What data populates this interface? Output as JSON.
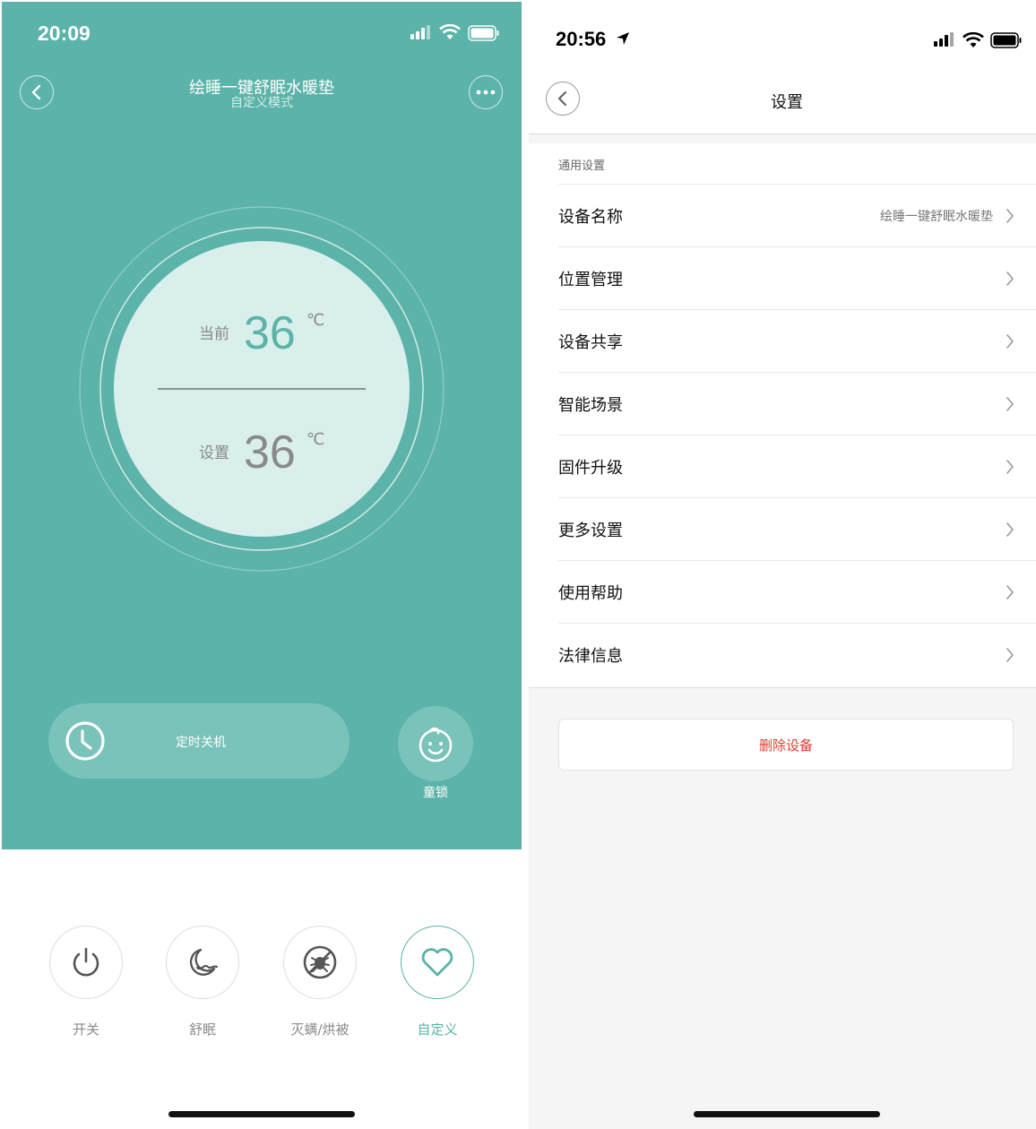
{
  "left": {
    "status_time": "20:09",
    "title": "绘睡一键舒眠水暖垫",
    "subtitle": "自定义模式",
    "current_label": "当前",
    "current_temp": "36",
    "set_label": "设置",
    "set_temp": "36",
    "unit": "℃",
    "timer_label": "定时关机",
    "child_lock_label": "童锁",
    "bottom": [
      {
        "label": "开关",
        "icon": "power-icon"
      },
      {
        "label": "舒眠",
        "icon": "moon-icon"
      },
      {
        "label": "灭螨/烘被",
        "icon": "bug-icon"
      },
      {
        "label": "自定义",
        "icon": "heart-icon"
      }
    ],
    "colors": {
      "teal": "#5bb3a9",
      "inner_circle": "#d9efeb",
      "accent": "#5bb3a9"
    }
  },
  "right": {
    "status_time": "20:56",
    "title": "设置",
    "section_header": "通用设置",
    "rows": [
      {
        "label": "设备名称",
        "value": "绘睡一键舒眠水暖垫"
      },
      {
        "label": "位置管理",
        "value": ""
      },
      {
        "label": "设备共享",
        "value": ""
      },
      {
        "label": "智能场景",
        "value": ""
      },
      {
        "label": "固件升级",
        "value": ""
      },
      {
        "label": "更多设置",
        "value": ""
      },
      {
        "label": "使用帮助",
        "value": ""
      },
      {
        "label": "法律信息",
        "value": ""
      }
    ],
    "delete_label": "删除设备",
    "colors": {
      "delete": "#e03a2f",
      "background": "#f5f5f5"
    }
  }
}
